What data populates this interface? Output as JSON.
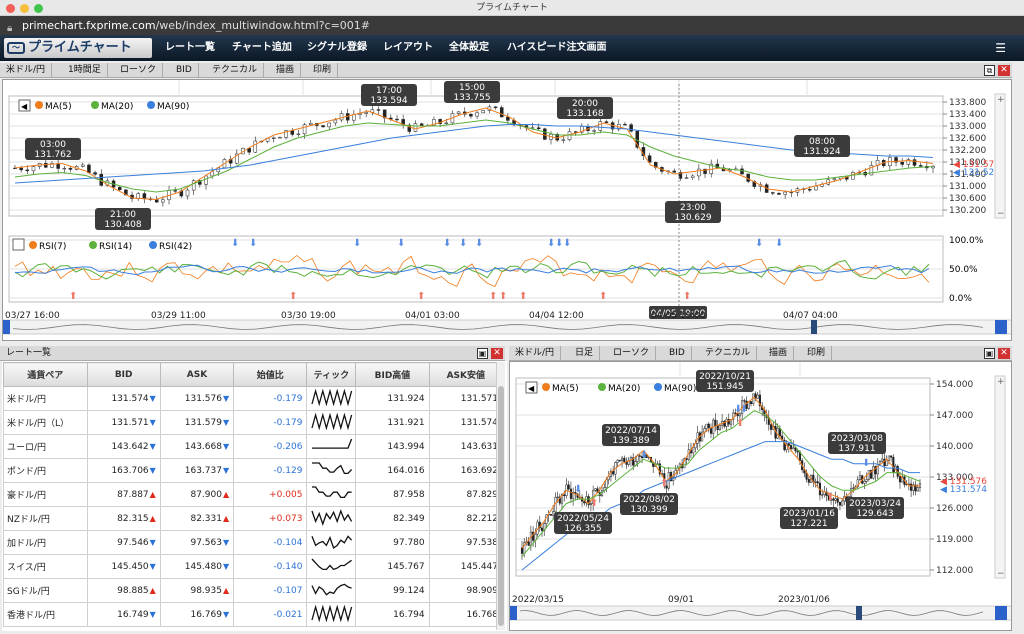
{
  "window": {
    "title": "プライムチャート"
  },
  "url": {
    "host": "primechart.fxprime.com",
    "path": "/web/index_multiwindow.html?c=001#"
  },
  "app": {
    "logo": "プライムチャート",
    "menu": [
      "レート一覧",
      "チャート追加",
      "シグナル登録",
      "レイアウト",
      "全体設定",
      "ハイスピード注文画面"
    ]
  },
  "icons": {
    "menu": "hamburger-icon",
    "up": "up-arrow-icon",
    "down": "down-arrow-icon",
    "close": "close-icon",
    "maximize": "maximize-icon"
  },
  "colors": {
    "ma5": "#f07c1c",
    "ma20": "#5cb23c",
    "ma90": "#3a7fdd",
    "bid_line": "#e8453c",
    "ask_line": "#3a7fdd"
  },
  "chart1": {
    "toolbar": [
      "米ドル/円",
      "1時間足",
      "ローソク",
      "BID",
      "テクニカル",
      "描画",
      "印刷"
    ],
    "legend": [
      "MA(5)",
      "MA(20)",
      "MA(90)"
    ],
    "rsi_legend": [
      "RSI(7)",
      "RSI(14)",
      "RSI(42)"
    ],
    "price_ticks": [
      "133.800",
      "133.400",
      "133.000",
      "132.600",
      "132.200",
      "131.800",
      "131.400",
      "131.000",
      "130.600",
      "130.200"
    ],
    "rsi_ticks": [
      "100.0%",
      "50.0%",
      "0.0%"
    ],
    "time_labels": [
      "03/27 16:00",
      "03/29 11:00",
      "03/30 19:00",
      "04/01 03:00",
      "04/04 12:00",
      "04/05 19:00",
      "04/07 04:00"
    ],
    "annotations": [
      {
        "time": "03:00",
        "price": "131.762"
      },
      {
        "time": "21:00",
        "price": "130.408"
      },
      {
        "time": "17:00",
        "price": "133.594"
      },
      {
        "time": "15:00",
        "price": "133.755"
      },
      {
        "time": "20:00",
        "price": "133.168"
      },
      {
        "time": "23:00",
        "price": "130.629"
      },
      {
        "time": "08:00",
        "price": "131.924"
      }
    ],
    "bid_label": "131.576",
    "ask_label": "131.524",
    "chart_data": {
      "type": "line",
      "series": [
        {
          "name": "MA(5)",
          "values": [
            131.6,
            131.7,
            131.75,
            131.5,
            131.0,
            130.6,
            130.55,
            130.8,
            131.3,
            131.8,
            132.3,
            132.7,
            132.9,
            133.1,
            133.3,
            133.5,
            133.2,
            132.9,
            133.1,
            133.4,
            133.6,
            133.3,
            132.8,
            132.6,
            132.8,
            133.1,
            132.9,
            131.7,
            131.4,
            131.5,
            131.6,
            131.3,
            130.9,
            130.8,
            131.0,
            131.2,
            131.5,
            131.8,
            131.85,
            131.75
          ]
        },
        {
          "name": "MA(20)",
          "values": [
            131.3,
            131.4,
            131.45,
            131.35,
            131.1,
            130.9,
            130.8,
            130.9,
            131.2,
            131.5,
            131.9,
            132.3,
            132.6,
            132.8,
            133.0,
            133.1,
            133.05,
            133.0,
            133.0,
            133.1,
            133.2,
            133.1,
            132.9,
            132.7,
            132.7,
            132.8,
            132.7,
            132.3,
            132.0,
            131.8,
            131.6,
            131.5,
            131.3,
            131.2,
            131.2,
            131.3,
            131.4,
            131.5,
            131.6,
            131.65
          ]
        },
        {
          "name": "MA(90)",
          "values": [
            131.1,
            131.15,
            131.2,
            131.25,
            131.3,
            131.35,
            131.4,
            131.45,
            131.5,
            131.6,
            131.7,
            131.85,
            132.0,
            132.15,
            132.3,
            132.45,
            132.6,
            132.7,
            132.8,
            132.9,
            133.0,
            133.05,
            133.05,
            133.0,
            133.0,
            132.95,
            132.9,
            132.8,
            132.7,
            132.6,
            132.5,
            132.4,
            132.3,
            132.2,
            132.15,
            132.1,
            132.05,
            132.0,
            132.0,
            131.95
          ]
        }
      ]
    }
  },
  "chart2": {
    "toolbar": [
      "米ドル/円",
      "日足",
      "ローソク",
      "BID",
      "テクニカル",
      "描画",
      "印刷"
    ],
    "legend": [
      "MA(5)",
      "MA(20)",
      "MA(90)"
    ],
    "price_ticks": [
      "154.000",
      "147.000",
      "140.000",
      "133.000",
      "126.000",
      "119.000",
      "112.000"
    ],
    "time_labels": [
      "2022/03/15",
      "09/01",
      "2023/01/06"
    ],
    "annotations": [
      {
        "time": "2022/10/21",
        "price": "151.945"
      },
      {
        "time": "2022/07/14",
        "price": "139.389"
      },
      {
        "time": "2022/08/02",
        "price": "130.399"
      },
      {
        "time": "2022/05/24",
        "price": "126.355"
      },
      {
        "time": "2023/03/08",
        "price": "137.911"
      },
      {
        "time": "2023/01/16",
        "price": "127.221"
      },
      {
        "time": "2023/03/24",
        "price": "129.643"
      }
    ],
    "bid_label": "131.576",
    "ask_label": "131.574",
    "chart_data": {
      "type": "line",
      "series": [
        {
          "name": "MA(5)",
          "values": [
            117,
            120,
            123,
            127,
            130,
            129,
            127,
            130,
            134,
            136,
            137,
            139,
            136,
            132,
            134,
            138,
            142,
            144,
            145,
            146,
            149,
            151,
            148,
            143,
            140,
            137,
            133,
            130,
            129,
            128,
            130,
            133,
            135,
            137,
            134,
            131,
            131
          ]
        },
        {
          "name": "MA(20)",
          "values": [
            115,
            118,
            121,
            124,
            127,
            128,
            128,
            129,
            131,
            133,
            135,
            137,
            136,
            135,
            135,
            136,
            139,
            141,
            143,
            144,
            146,
            148,
            147,
            145,
            142,
            139,
            136,
            133,
            131,
            130,
            130,
            131,
            132,
            134,
            134,
            133,
            132
          ]
        },
        {
          "name": "MA(90)",
          "values": [
            112,
            114,
            116,
            118,
            120,
            122,
            123,
            124,
            126,
            127,
            128,
            130,
            131,
            132,
            133,
            134,
            135,
            136,
            137,
            138,
            139,
            140,
            141,
            141,
            141,
            140,
            139,
            138,
            137,
            137,
            136,
            136,
            136,
            135,
            135,
            134,
            134
          ]
        }
      ]
    }
  },
  "rates": {
    "title": "レート一覧",
    "headers": [
      "通貨ペア",
      "BID",
      "ASK",
      "始値比",
      "ティック",
      "BID高値",
      "ASK安値"
    ],
    "rows": [
      {
        "pair": "米ドル/円",
        "bid": "131.574",
        "ask": "131.576",
        "dir": "down",
        "change": "-0.179",
        "high": "131.924",
        "low": "131.571",
        "tick": [
          0,
          1,
          0,
          1,
          0,
          1,
          0,
          1,
          0,
          1,
          0,
          1
        ]
      },
      {
        "pair": "米ドル/円（L）",
        "bid": "131.571",
        "ask": "131.579",
        "dir": "down",
        "change": "-0.179",
        "high": "131.921",
        "low": "131.574",
        "tick": [
          0,
          1,
          0,
          1,
          0,
          1,
          0,
          1,
          0,
          1,
          0,
          1
        ]
      },
      {
        "pair": "ユーロ/円",
        "bid": "143.642",
        "ask": "143.668",
        "dir": "down",
        "change": "-0.206",
        "high": "143.994",
        "low": "143.631",
        "tick": [
          0.3,
          0.3,
          0.3,
          0.3,
          0.3,
          0.3,
          0.3,
          0.3,
          0.3,
          0.3,
          0.3,
          1
        ]
      },
      {
        "pair": "ポンド/円",
        "bid": "163.706",
        "ask": "163.737",
        "dir": "down",
        "change": "-0.129",
        "high": "164.016",
        "low": "163.692",
        "tick": [
          1,
          1,
          1,
          0.6,
          0.6,
          0.3,
          0.3,
          0.6,
          0.8,
          0.2,
          0.2,
          0.5
        ]
      },
      {
        "pair": "豪ドル/円",
        "bid": "87.887",
        "ask": "87.900",
        "dir": "up",
        "change": "+0.005",
        "high": "87.958",
        "low": "87.829",
        "tick": [
          1,
          1,
          0.6,
          0.6,
          0.3,
          0.3,
          0.6,
          0.6,
          0.2,
          0.2,
          0.6,
          0.6
        ]
      },
      {
        "pair": "NZドル/円",
        "bid": "82.315",
        "ask": "82.331",
        "dir": "up",
        "change": "+0.073",
        "high": "82.349",
        "low": "82.212",
        "tick": [
          1,
          0.2,
          0.8,
          0,
          0.8,
          0.4,
          0.9,
          0.2,
          1,
          0.3,
          0.7,
          0.2
        ]
      },
      {
        "pair": "加ドル/円",
        "bid": "97.546",
        "ask": "97.563",
        "dir": "down",
        "change": "-0.104",
        "high": "97.780",
        "low": "97.538",
        "tick": [
          0.9,
          0.2,
          0.4,
          0.5,
          0.2,
          0.8,
          0,
          0.2,
          0.6,
          0.4,
          0.9,
          0.6
        ]
      },
      {
        "pair": "スイス/円",
        "bid": "145.450",
        "ask": "145.480",
        "dir": "down",
        "change": "-0.140",
        "high": "145.767",
        "low": "145.447",
        "tick": [
          1,
          0.7,
          0.4,
          0.2,
          0.2,
          0.5,
          0.2,
          0.3,
          0.5,
          0.5,
          0.7,
          0.9
        ]
      },
      {
        "pair": "SGドル/円",
        "bid": "98.885",
        "ask": "98.935",
        "dir": "up",
        "change": "-0.107",
        "high": "99.124",
        "low": "98.909",
        "tick": [
          0.8,
          0.2,
          0.7,
          0.5,
          0.1,
          0.3,
          0.2,
          0.6,
          0.8,
          0.9,
          0.7,
          0.6
        ]
      },
      {
        "pair": "香港ドル/円",
        "bid": "16.749",
        "ask": "16.769",
        "dir": "down",
        "change": "-0.021",
        "high": "16.794",
        "low": "16.768",
        "tick": [
          0,
          1,
          0,
          1,
          0,
          1,
          0,
          1,
          0,
          1,
          0,
          1
        ]
      }
    ]
  }
}
